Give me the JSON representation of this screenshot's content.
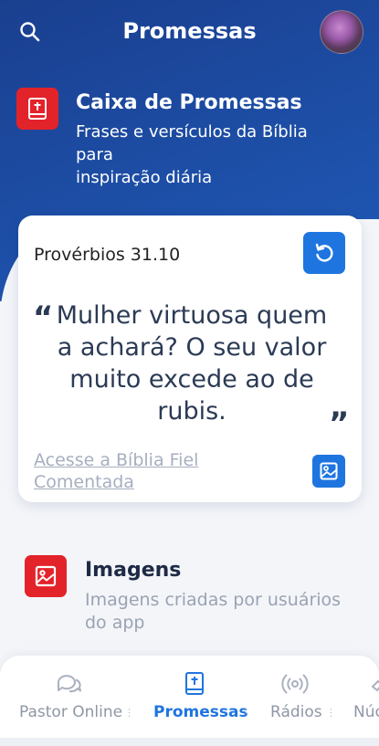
{
  "header": {
    "title": "Promessas"
  },
  "promises_section": {
    "title": "Caixa de Promessas",
    "description_line1": "Frases e versículos da Bíblia",
    "description_line2": "para",
    "description_line3": "inspiração diária"
  },
  "verse_card": {
    "reference": "Provérbios 31.10",
    "text": "Mulher virtuosa quem a achará? O seu valor muito excede ao de rubis.",
    "quote_open": "“",
    "quote_close": "”",
    "link_text": "Acesse a Bíblia Fiel Comentada"
  },
  "images_section": {
    "title": "Imagens",
    "description": "Imagens criadas por usuários do app"
  },
  "bottom_nav": {
    "items": [
      {
        "label": "Pastor Online",
        "icon": "chat-icon",
        "active": false
      },
      {
        "label": "Promessas",
        "icon": "bible-icon",
        "active": true
      },
      {
        "label": "Rádios",
        "icon": "radio-icon",
        "active": false
      },
      {
        "label": "Núc",
        "icon": "hands-icon",
        "active": false
      }
    ]
  },
  "colors": {
    "header_blue": "#1d4ea6",
    "accent_red": "#e3232a",
    "button_blue": "#1f75e0",
    "active_tab": "#1f75e0"
  }
}
